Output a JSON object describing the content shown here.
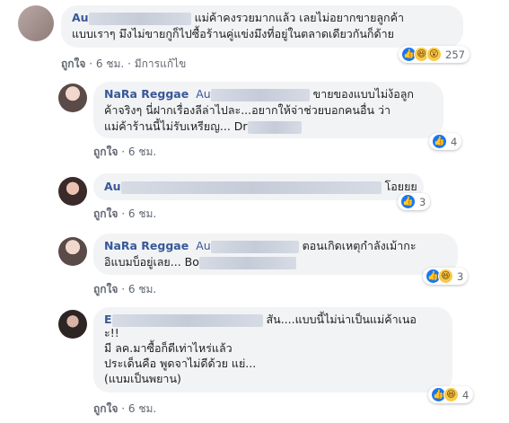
{
  "comments": [
    {
      "name": "Au",
      "text_line1": "แม่ค้าคงรวยมากแล้ว เลยไม่อยากขายลูกค้า",
      "text_line2": "แบบเราๆ มึงไม่ขายกูก็ไปซื้อร้านคู่แข่งมึงที่อยู่ในตลาดเดียวกันก็ด้าย",
      "like_label": "ถูกใจ",
      "time": "6 ชม.",
      "edited": "มีการแก้ไข",
      "reaction_count": "257",
      "reactions": [
        "like-icon",
        "haha-icon",
        "wow-icon"
      ]
    },
    {
      "name": "NaRa Reggae",
      "tag": "Au",
      "text_line1_tail": "ขายของแบบไม่ง้อลูก",
      "text_line2": "ค้าจริงๆ นี่ฝากเรื่องลีล่าไปละ...อยากให้จ่าช่วยบอกคนอื่น ว่า",
      "text_line3": "แม่ค้าร้านนี้ไม่รับเหรียญ... Dr",
      "like_label": "ถูกใจ",
      "time": "6 ชม.",
      "reaction_count": "4",
      "reactions": [
        "like-icon"
      ]
    },
    {
      "name": "Au",
      "text_tail": "โอยยย",
      "like_label": "ถูกใจ",
      "time": "6 ชม.",
      "reaction_count": "3",
      "reactions": [
        "like-icon"
      ]
    },
    {
      "name": "NaRa Reggae",
      "tag": "Au",
      "text_line1_tail": "ตอนเกิดเหตุกำลังเม้ากะ",
      "text_line2": "อิแบมบ็อยู่เลย... Bo",
      "like_label": "ถูกใจ",
      "time": "6 ชม.",
      "reaction_count": "3",
      "reactions": [
        "like-icon",
        "haha-icon"
      ]
    },
    {
      "name": "E",
      "text_line1_tail": "สัน....แบบนี้ไม่น่าเป็นแม่ค้าเนอ",
      "text_line2": "ะ!!",
      "text_line3": "มี ลค.มาซื้อก็ดีเท่าไหร่แล้ว",
      "text_line4": "ประเด็นคือ พูดจาไม่ดีด้วย แย่...",
      "text_line5": "(แบมเป็นพยาน)",
      "like_label": "ถูกใจ",
      "time": "6 ชม.",
      "reaction_count": "4",
      "reactions": [
        "like-icon",
        "haha-icon"
      ]
    }
  ],
  "separator": "·"
}
